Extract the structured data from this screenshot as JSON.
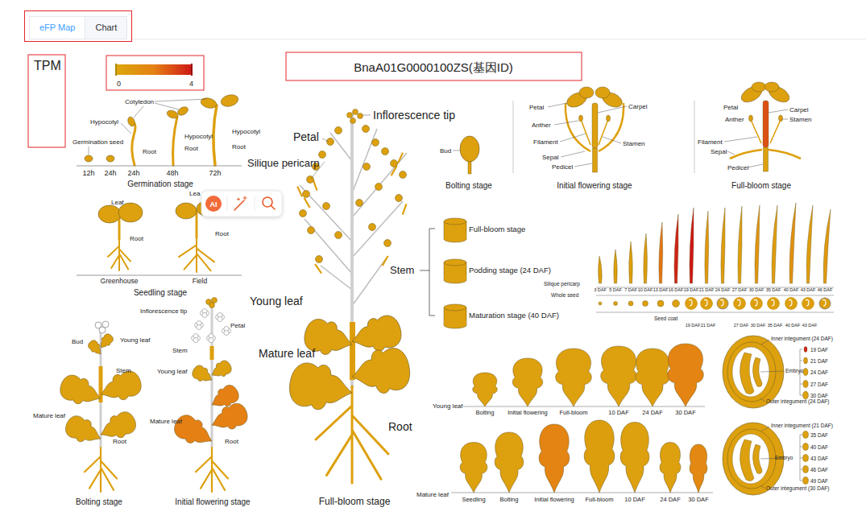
{
  "tabs": [
    {
      "label": "eFP Map",
      "selected": true
    },
    {
      "label": "Chart",
      "selected": false
    }
  ],
  "unit_label": "TPM",
  "color_scale": {
    "min": "0",
    "max": "4"
  },
  "gene_title": "BnaA01G0000100ZS(基因ID)",
  "overlay_toolbar": {
    "ai_label": "AI"
  },
  "germination": {
    "caption": "Germination stage",
    "labels": [
      "Cotyledon",
      "Hypocotyl",
      "Germination seed",
      "Root",
      "Hypocotyl",
      "Root",
      "Hypocotyl",
      "Root"
    ],
    "samples": [
      {
        "time": "12h",
        "level": 0.14
      },
      {
        "time": "24h",
        "level": 0.1
      },
      {
        "time": "24h",
        "level": 0.1
      },
      {
        "time": "48h",
        "level": 0.12
      },
      {
        "time": "72h",
        "level": 0.1
      }
    ]
  },
  "seedling": {
    "caption": "Seedling stage",
    "samples": [
      {
        "name": "Greenhouse",
        "leaf_label": "Leaf",
        "root_label": "Root",
        "leaf_level": 0.1,
        "root_level": 0.1
      },
      {
        "name": "Field",
        "leaf_label": "Lea",
        "root_label": "Root",
        "leaf_level": 0.1,
        "root_level": 0.12
      }
    ]
  },
  "bolting_plant": {
    "caption": "Bolting stage",
    "labels": {
      "bud": "Bud",
      "young_leaf": "Young leaf",
      "stem": "Stem",
      "mature_leaf": "Mature leaf",
      "root": "Root"
    },
    "levels": {
      "young_leaf": 0.1,
      "stem": 0.1,
      "mature_leaf": 0.1,
      "root": 0.1
    }
  },
  "flowering_plant": {
    "caption": "Initial flowering stage",
    "labels": {
      "inflorescence_tip": "Inflorescence tip",
      "petal": "Petal",
      "stem": "Stem",
      "young_leaf": "Young leaf",
      "mature_leaf": "Mature leaf",
      "root": "Root"
    },
    "levels": {
      "inflorescence_tip": 0.1,
      "stem": 0.1,
      "young_leaf": 0.1,
      "mature_leaf": 0.5,
      "root": 0.1
    }
  },
  "fullbloom_plant": {
    "caption": "Full-bloom stage",
    "labels": {
      "petal": "Petal",
      "inflorescence_tip": "Inflorescence tip",
      "silique_pericarp": "Silique pericarp",
      "young_leaf": "Young leaf",
      "mature_leaf": "Mature leaf",
      "root": "Root"
    },
    "levels": {
      "petal": 0.1,
      "inflorescence_tip": 0.1,
      "silique_pericarp": 0.1,
      "stem": 0.12,
      "young_leaf": 0.1,
      "mature_leaf": 0.1,
      "root": 0.1
    }
  },
  "bud": {
    "label": "Bud",
    "caption": "Bolting stage",
    "level": 0.1
  },
  "flower_initial": {
    "caption": "Initial flowering stage",
    "labels": {
      "petal": "Petal",
      "anther": "Anther",
      "filament": "Filament",
      "sepal": "Sepal",
      "pedicel": "Pedicel",
      "carpel": "Carpel",
      "stamen": "Stamen"
    },
    "levels": {
      "petal": 0.1,
      "anther": 0.12,
      "filament": 0.1,
      "sepal": 0.1,
      "pedicel": 0.1,
      "carpel": 0.1
    }
  },
  "flower_fullbloom": {
    "caption": "Full-bloom stage",
    "labels": {
      "petal": "Petal",
      "anther": "Anther",
      "filament": "Filament",
      "sepal": "Sepal",
      "pedicel": "Pedicel",
      "carpel": "Carpel",
      "stamen": "Stamen"
    },
    "levels": {
      "petal": 0.1,
      "anther": 0.12,
      "filament": 0.1,
      "sepal": 0.1,
      "pedicel": 0.1,
      "carpel": 0.72
    }
  },
  "stem": {
    "label": "Stem",
    "samples": [
      {
        "name": "Full-bloom stage",
        "level": 0.1
      },
      {
        "name": "Podding stage (24 DAF)",
        "level": 0.1
      },
      {
        "name": "Maturation stage (40 DAF)",
        "level": 0.1
      }
    ]
  },
  "silique_series": {
    "pericarp_label": "Silique pericarp",
    "whole_seed_label": "Whole seed",
    "seed_coat_label": "Seed coat",
    "stages": [
      {
        "day": "3 DAF",
        "pericarp_level": 0.1,
        "seed_level": 0.1
      },
      {
        "day": "5 DAF",
        "pericarp_level": 0.1,
        "seed_level": 0.1
      },
      {
        "day": "7 DAF",
        "pericarp_level": 0.1,
        "seed_level": 0.1
      },
      {
        "day": "10 DAF",
        "pericarp_level": 0.12,
        "seed_level": 0.1
      },
      {
        "day": "13 DAF",
        "pericarp_level": 0.55,
        "seed_level": 0.1
      },
      {
        "day": "16 DAF",
        "pericarp_level": 0.95,
        "seed_level": 0.1
      },
      {
        "day": "19 DAF",
        "pericarp_level": 1.0,
        "seed_level": 0.1
      },
      {
        "day": "21 DAF",
        "pericarp_level": 0.2,
        "seed_level": 0.1
      },
      {
        "day": "24 DAF",
        "pericarp_level": 0.15,
        "seed_level": 0.1
      },
      {
        "day": "27 DAF",
        "pericarp_level": 0.12,
        "seed_level": 0.1
      },
      {
        "day": "30 DAF",
        "pericarp_level": 0.25,
        "seed_level": 0.1
      },
      {
        "day": "35 DAF",
        "pericarp_level": 0.15,
        "seed_level": 0.1
      },
      {
        "day": "40 DAF",
        "pericarp_level": 0.3,
        "seed_level": 0.1
      },
      {
        "day": "43 DAF",
        "pericarp_level": 0.15,
        "seed_level": 0.12
      },
      {
        "day": "46 DAF",
        "pericarp_level": 0.2,
        "seed_level": 0.12
      }
    ],
    "seed_coat": [
      {
        "day": "19 DAF",
        "level": 0.1
      },
      {
        "day": "21 DAF",
        "level": 0.1
      },
      {
        "day": "27 DAF",
        "level": 0.1
      },
      {
        "day": "30 DAF",
        "level": 0.1
      },
      {
        "day": "35 DAF",
        "level": 0.1
      },
      {
        "day": "40 DAF",
        "level": 0.1
      },
      {
        "day": "43 DAF",
        "level": 0.1
      }
    ]
  },
  "young_leaf_series": {
    "label": "Young leaf",
    "samples": [
      {
        "name": "Bolting",
        "level": 0.1
      },
      {
        "name": "Initial flowering",
        "level": 0.1
      },
      {
        "name": "Full-bloom",
        "level": 0.1
      },
      {
        "name": "10 DAF",
        "level": 0.1
      },
      {
        "name": "24 DAF",
        "level": 0.12
      },
      {
        "name": "30 DAF",
        "level": 0.45
      }
    ]
  },
  "mature_leaf_series": {
    "label": "Mature leaf",
    "samples": [
      {
        "name": "Seedling",
        "level": 0.1
      },
      {
        "name": "Bolting",
        "level": 0.1
      },
      {
        "name": "Initial flowering",
        "level": 0.45
      },
      {
        "name": "Full-bloom",
        "level": 0.12
      },
      {
        "name": "10 DAF",
        "level": 0.1
      },
      {
        "name": "24 DAF",
        "level": 0.1
      },
      {
        "name": "30 DAF",
        "level": 0.4
      }
    ]
  },
  "seed_sections": [
    {
      "inner_label": "Inner integument (24 DAF)",
      "embryo_label": "Embryo",
      "outer_label": "Outer integument (24 DAF)",
      "inner_level": 0.1,
      "outer_level": 0.1,
      "embryo_level": 0.1,
      "embryo_stages": [
        {
          "day": "19 DAF",
          "level": 0.95
        },
        {
          "day": "21 DAF",
          "level": 0.12
        },
        {
          "day": "24 DAF",
          "level": 0.1
        },
        {
          "day": "27 DAF",
          "level": 0.1
        },
        {
          "day": "30 DAF",
          "level": 0.1
        }
      ]
    },
    {
      "inner_label": "Inner integument (21 DAF)",
      "embryo_label": "Embryo",
      "outer_label": "Outer integument (30 DAF)",
      "inner_level": 0.1,
      "outer_level": 0.1,
      "embryo_level": 0.1,
      "embryo_stages": [
        {
          "day": "35 DAF",
          "level": 0.1
        },
        {
          "day": "40 DAF",
          "level": 0.1
        },
        {
          "day": "43 DAF",
          "level": 0.1
        },
        {
          "day": "46 DAF",
          "level": 0.1
        },
        {
          "day": "49 DAF",
          "level": 0.1
        }
      ]
    }
  ]
}
